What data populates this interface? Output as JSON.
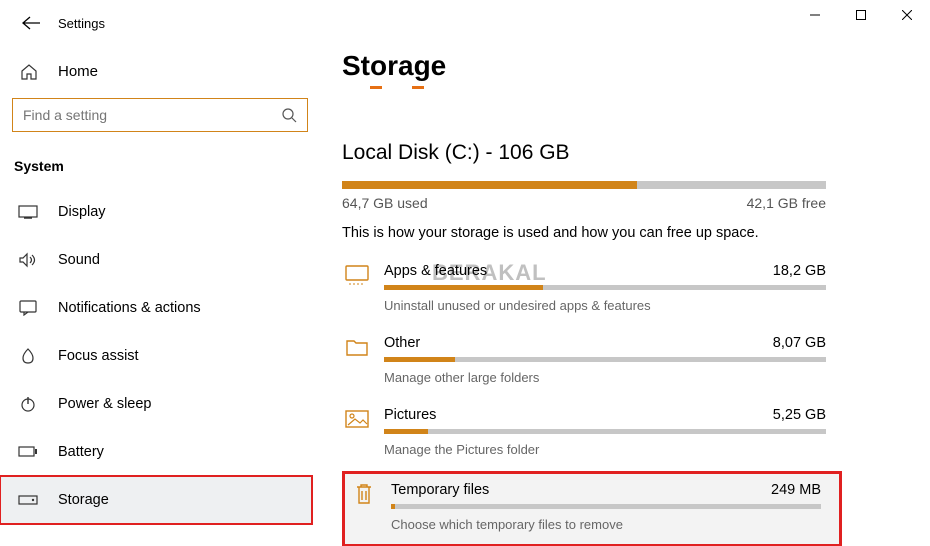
{
  "header": {
    "title": "Settings"
  },
  "home": {
    "label": "Home"
  },
  "search": {
    "placeholder": "Find a setting"
  },
  "section": {
    "label": "System"
  },
  "nav": {
    "items": [
      {
        "label": "Display"
      },
      {
        "label": "Sound"
      },
      {
        "label": "Notifications & actions"
      },
      {
        "label": "Focus assist"
      },
      {
        "label": "Power & sleep"
      },
      {
        "label": "Battery"
      },
      {
        "label": "Storage"
      }
    ]
  },
  "main": {
    "title": "Storage",
    "disk_title": "Local Disk (C:) - 106 GB",
    "used_label": "64,7 GB used",
    "free_label": "42,1 GB free",
    "used_pct": 61,
    "description": "This is how your storage is used and how you can free up space.",
    "categories": [
      {
        "name": "Apps & features",
        "size": "18,2 GB",
        "sub": "Uninstall unused or undesired apps & features",
        "pct": 36
      },
      {
        "name": "Other",
        "size": "8,07 GB",
        "sub": "Manage other large folders",
        "pct": 16
      },
      {
        "name": "Pictures",
        "size": "5,25 GB",
        "sub": "Manage the Pictures folder",
        "pct": 10
      },
      {
        "name": "Temporary files",
        "size": "249 MB",
        "sub": "Choose which temporary files to remove",
        "pct": 1
      }
    ]
  },
  "watermark": "BERAKAL"
}
